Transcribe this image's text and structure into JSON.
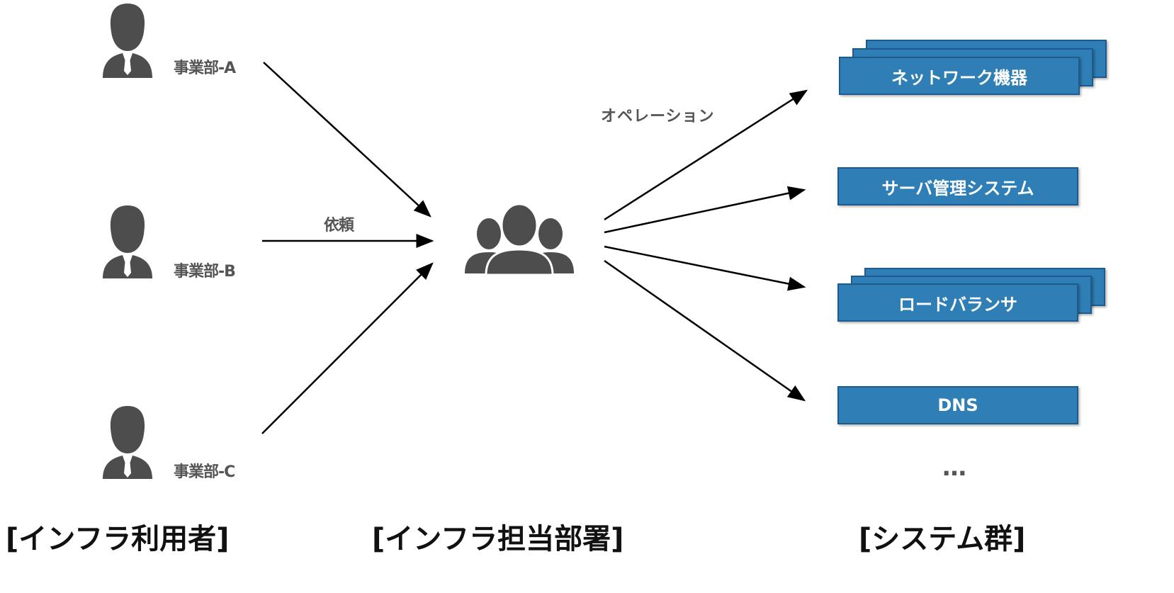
{
  "users": [
    {
      "label": "事業部-A"
    },
    {
      "label": "事業部-B"
    },
    {
      "label": "事業部-C"
    }
  ],
  "request_label": "依頼",
  "operation_label": "オペレーション",
  "systems": [
    {
      "label": "ネットワーク機器",
      "stacked": true
    },
    {
      "label": "サーバ管理システム",
      "stacked": false
    },
    {
      "label": "ロードバランサ",
      "stacked": true
    },
    {
      "label": "DNS",
      "stacked": false
    }
  ],
  "ellipsis": "…",
  "captions": {
    "users": "[インフラ利用者]",
    "team": "[インフラ担当部署]",
    "systems": "[システム群]"
  },
  "colors": {
    "box": "#2f7fb6",
    "box_border": "#1d5a8e",
    "icon": "#4d4d4d"
  }
}
